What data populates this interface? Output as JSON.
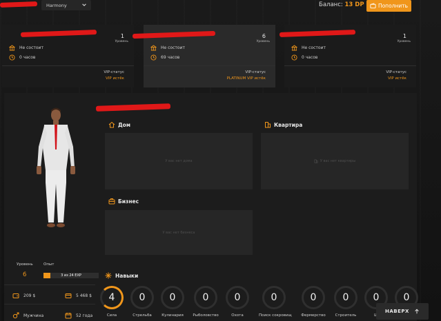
{
  "topbar": {
    "server": "Harmony",
    "balance_label": "Баланс:",
    "balance_value": "13 DP",
    "topup_label": "Пополнить"
  },
  "characters": [
    {
      "level": "1",
      "level_label": "Уровень",
      "faction": "Не состоит",
      "hours": "0 часов",
      "vip_label": "VIP-статус",
      "vip_value": "VIP истёк",
      "active": false
    },
    {
      "level": "6",
      "level_label": "Уровень",
      "faction": "Не состоит",
      "hours": "69 часов",
      "vip_label": "VIP-статус",
      "vip_value": "PLATINUM VIP истёк",
      "active": true
    },
    {
      "level": "1",
      "level_label": "Уровень",
      "faction": "Не состоит",
      "hours": "0 часов",
      "vip_label": "VIP-статус",
      "vip_value": "VIP истёк",
      "active": false
    }
  ],
  "profile": {
    "level_label": "Уровень",
    "level_value": "6",
    "exp_label": "Опыт",
    "exp_text": "3 из 24 EXP",
    "exp_fraction": 0.125,
    "cash": "209 $",
    "bank": "5 468 $",
    "gender": "Мужчина",
    "age": "52 года"
  },
  "property": {
    "house_title": "Дом",
    "house_empty": "У вас нет дома",
    "apartment_title": "Квартира",
    "apartment_empty": "У вас нет квартиры",
    "business_title": "Бизнес",
    "business_empty": "У вас нет бизнеса"
  },
  "skills": {
    "title": "Навыки",
    "items": [
      {
        "name": "Сила",
        "value": "4",
        "hot": true
      },
      {
        "name": "Стрельба",
        "value": "0",
        "hot": false
      },
      {
        "name": "Кулинария",
        "value": "0",
        "hot": false
      },
      {
        "name": "Рыболовство",
        "value": "0",
        "hot": false
      },
      {
        "name": "Охота",
        "value": "0",
        "hot": false
      },
      {
        "name": "Поиск сокровищ",
        "value": "0",
        "hot": false
      },
      {
        "name": "Фермерство",
        "value": "0",
        "hot": false
      },
      {
        "name": "Строитель",
        "value": "0",
        "hot": false
      },
      {
        "name": "Ш",
        "value": "0",
        "hot": false
      },
      {
        "name": "",
        "value": "0",
        "hot": false
      }
    ]
  },
  "up_button": "НАВЕРХ",
  "colors": {
    "accent": "#f0961b",
    "panel": "#1c1c1c",
    "box": "#262626"
  }
}
